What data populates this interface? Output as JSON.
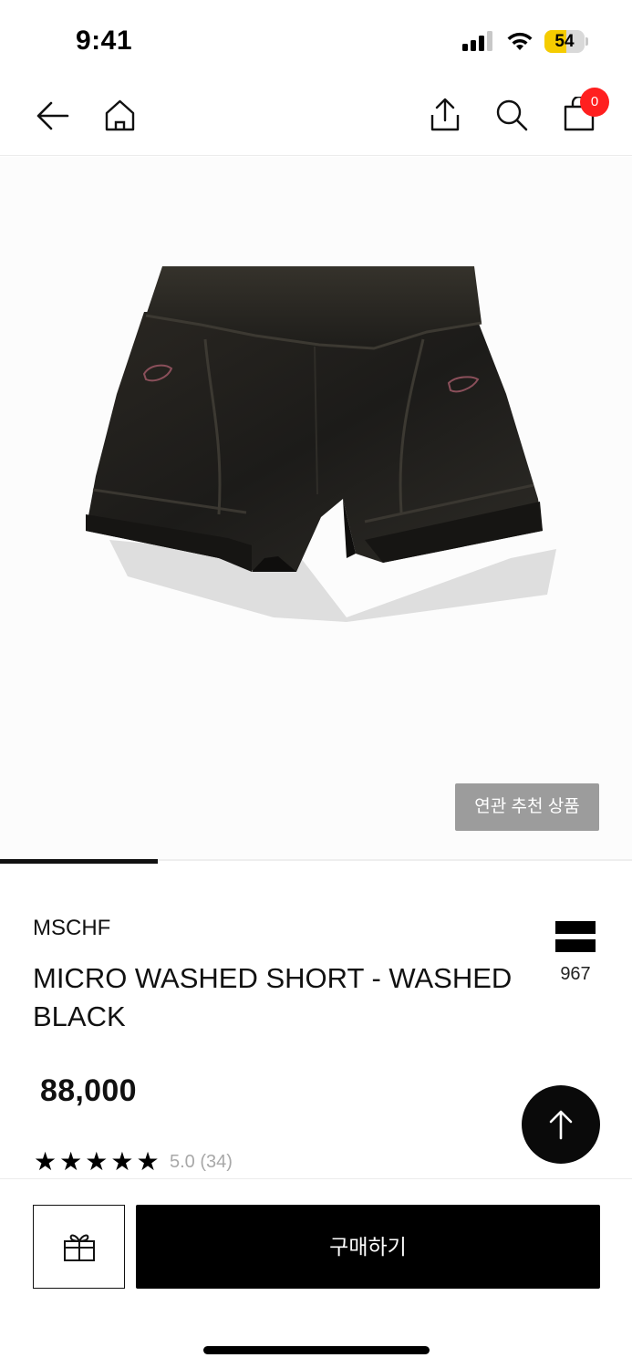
{
  "status_bar": {
    "time": "9:41",
    "battery_level": "54",
    "battery_color": "#f5cc00",
    "signal_icon": "cellular-signal-icon",
    "wifi_icon": "wifi-icon"
  },
  "nav": {
    "back_icon": "arrow-left-icon",
    "home_icon": "home-icon",
    "share_icon": "share-icon",
    "search_icon": "search-icon",
    "cart_icon": "shopping-bag-icon",
    "cart_count": "0",
    "cart_badge_color": "#ff1f1f"
  },
  "gallery": {
    "image_count_progress": 0.25,
    "related_button_label": "연관 추천 상품"
  },
  "product": {
    "brand": "MSCHF",
    "title": "MICRO WASHED SHORT - WASHED BLACK",
    "like_icon": "brand-logo-icon",
    "like_count": "967",
    "price": "88,000",
    "rating_stars": 5,
    "rating_text": "5.0 (34)"
  },
  "actions": {
    "scroll_top_icon": "arrow-up-icon",
    "gift_icon": "gift-icon",
    "buy_label": "구매하기"
  }
}
